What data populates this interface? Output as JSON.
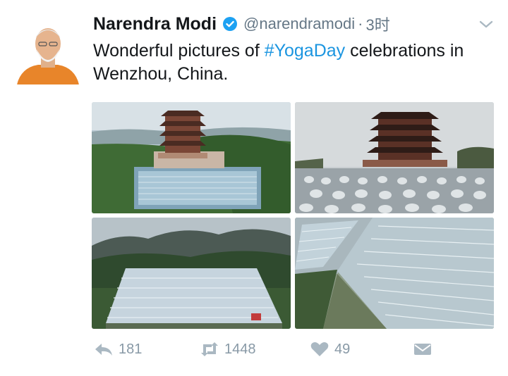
{
  "tweet": {
    "author_name": "Narendra Modi",
    "handle": "@narendramodi",
    "separator": "·",
    "time": "3时",
    "text_before": "Wonderful pictures of ",
    "hashtag": "#YogaDay",
    "text_after": " celebrations in Wenzhou, China.",
    "verified_icon": "verified-badge-icon",
    "menu_icon": "chevron-down-icon",
    "hashtag_color": "#1b95e0",
    "verified_color": "#1da1f2"
  },
  "actions": {
    "reply_count": "181",
    "retweet_count": "1448",
    "like_count": "49",
    "reply_icon": "reply-icon",
    "retweet_icon": "retweet-icon",
    "like_icon": "heart-icon",
    "dm_icon": "direct-message-icon"
  }
}
